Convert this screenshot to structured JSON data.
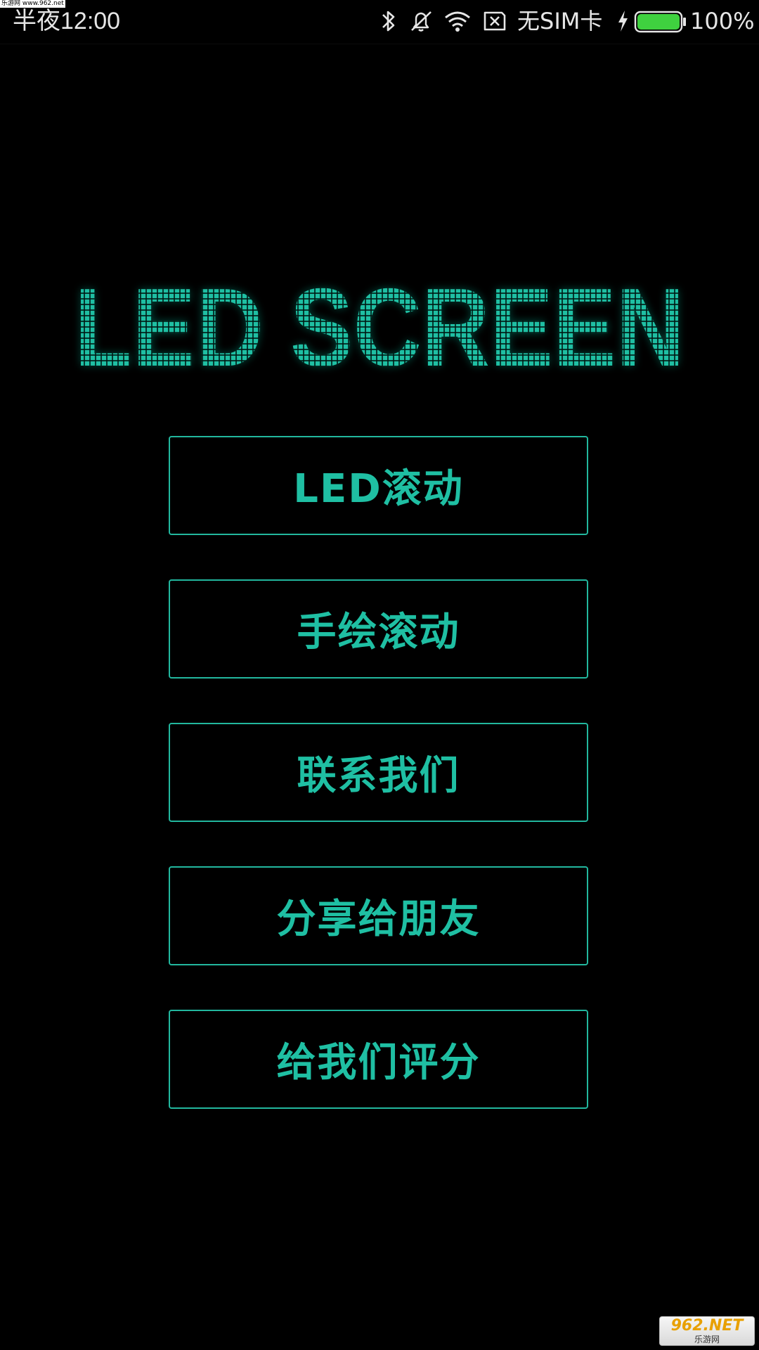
{
  "status_bar": {
    "time": "半夜12:00",
    "sim_status": "无SIM卡",
    "battery_percent_text": "100%",
    "battery_level": 1.0,
    "icons": [
      "bluetooth-icon",
      "mute-icon",
      "wifi-icon",
      "no-sim-icon",
      "charging-icon",
      "battery-icon"
    ]
  },
  "title": {
    "text": "LED SCREEN",
    "color": "#1fbfa3"
  },
  "menu": {
    "items": [
      {
        "label": "LED滚动"
      },
      {
        "label": "手绘滚动"
      },
      {
        "label": "联系我们"
      },
      {
        "label": "分享给朋友"
      },
      {
        "label": "给我们评分"
      }
    ]
  },
  "watermarks": {
    "top_text": "乐游网 www.962.net",
    "bottom_main": "962.NET",
    "bottom_sub": "乐游网"
  },
  "colors": {
    "background": "#000000",
    "accent": "#1fbfa3",
    "border": "#22b79e",
    "status_text": "#e6e6e6",
    "battery_fill": "#3fd13f"
  }
}
